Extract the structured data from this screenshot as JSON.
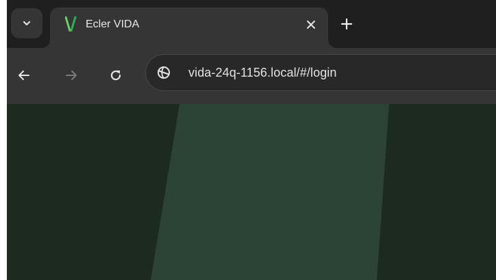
{
  "tabs": [
    {
      "title": "Ecler VIDA",
      "favicon": "vida-v-logo-icon",
      "active": true
    }
  ],
  "tab_strip": {
    "search_icon": "chevron-down-icon",
    "close_icon": "close-icon",
    "new_tab_icon": "plus-icon"
  },
  "toolbar": {
    "back_icon": "arrow-left-icon",
    "forward_icon": "arrow-right-icon",
    "reload_icon": "reload-icon",
    "site_info_icon": "globe-icon"
  },
  "address_bar": {
    "url": "vida-24q-1156.local/#/login"
  },
  "colors": {
    "tabstrip_bg": "#1f1f1f",
    "toolbar_bg": "#353535",
    "page_bg": "#1c2a20",
    "stripe": "#2b4434",
    "favicon_green": "#3fbf6a"
  }
}
